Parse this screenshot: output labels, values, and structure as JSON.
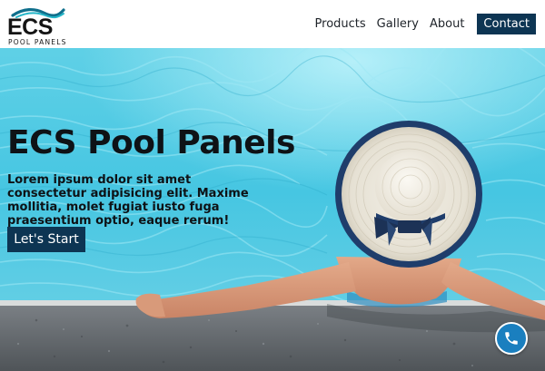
{
  "brand": {
    "name": "ECS",
    "tagline": "POOL PANELS",
    "colors": {
      "wave_dark": "#0f6f8c",
      "wave_light": "#24b6c8",
      "text": "#141414"
    }
  },
  "nav": {
    "items": [
      "Products",
      "Gallery",
      "About"
    ],
    "contact_label": "Contact"
  },
  "hero": {
    "title": "ECS Pool Panels",
    "text": "Lorem ipsum dolor sit amet consectetur adipisicing elit. Maxime mollitia, molet fugiat iusto fuga praesentium optio, eaque rerum!",
    "cta_label": "Let's Start",
    "image_description_icon": "pool-woman-hat-image"
  },
  "floating": {
    "icon": "phone-icon"
  },
  "colors": {
    "accent": "#0d3553",
    "water": "#46c6e2",
    "phone_button": "#1a7fbf"
  }
}
